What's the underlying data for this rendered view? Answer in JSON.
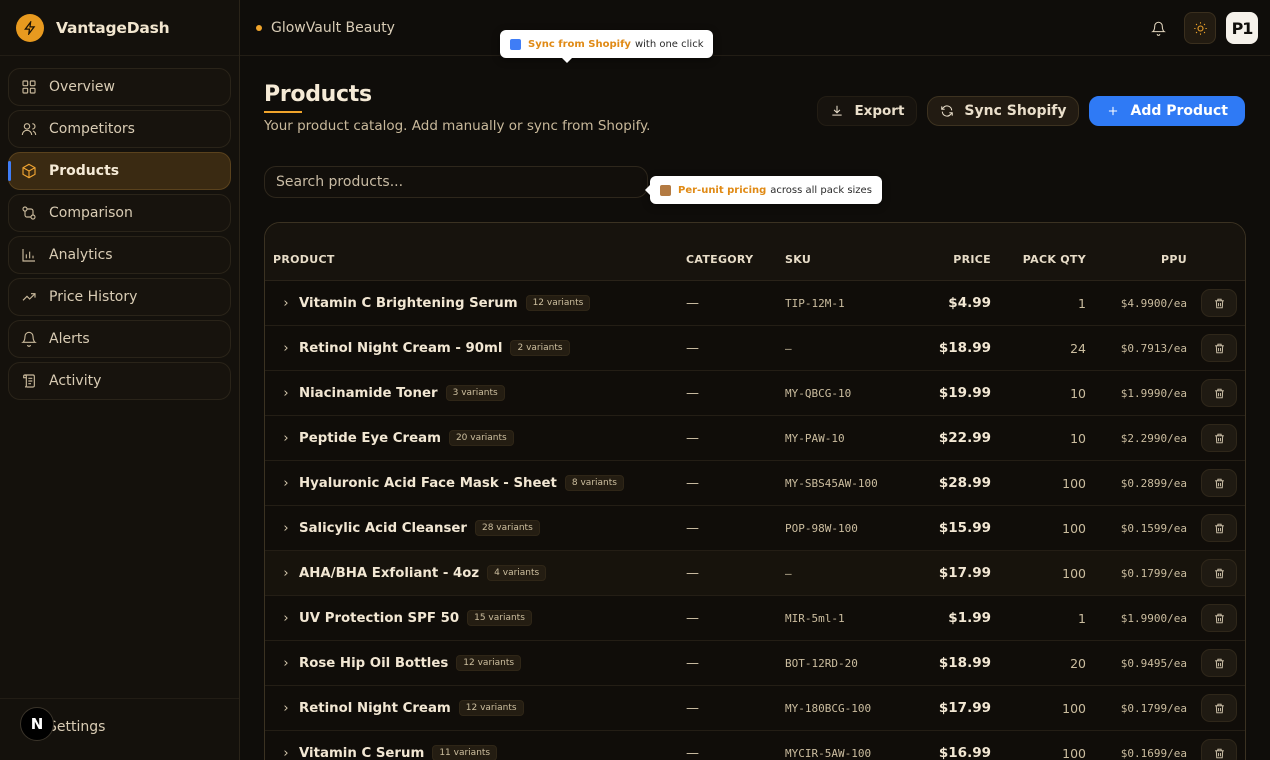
{
  "brand": {
    "name": "VantageDash"
  },
  "nav": [
    {
      "label": "Overview",
      "icon": "grid-icon",
      "active": false
    },
    {
      "label": "Competitors",
      "icon": "users-icon",
      "active": false
    },
    {
      "label": "Products",
      "icon": "box-icon",
      "active": true
    },
    {
      "label": "Comparison",
      "icon": "compare-icon",
      "active": false
    },
    {
      "label": "Analytics",
      "icon": "bar-chart-icon",
      "active": false
    },
    {
      "label": "Price History",
      "icon": "trend-icon",
      "active": false
    },
    {
      "label": "Alerts",
      "icon": "bell-icon",
      "active": false
    },
    {
      "label": "Activity",
      "icon": "scroll-icon",
      "active": false
    }
  ],
  "settings_label": "Settings",
  "next_badge": "N",
  "topbar": {
    "store": "GlowVault Beauty",
    "avatar": "P1"
  },
  "tooltips": {
    "sync_bold": "Sync from Shopify",
    "sync_rest": "with one click",
    "ppu_bold": "Per-unit pricing",
    "ppu_rest": "across all pack sizes"
  },
  "page": {
    "title": "Products",
    "subtitle": "Your product catalog. Add manually or sync from Shopify."
  },
  "actions": {
    "export": "Export",
    "sync": "Sync Shopify",
    "add": "Add Product"
  },
  "search": {
    "placeholder": "Search products..."
  },
  "table": {
    "headers": {
      "product": "PRODUCT",
      "category": "CATEGORY",
      "sku": "SKU",
      "price": "PRICE",
      "pack_qty": "PACK QTY",
      "ppu": "PPU"
    },
    "rows": [
      {
        "name": "Vitamin C Brightening Serum",
        "variants": "12 variants",
        "category": "—",
        "sku": "TIP-12M-1",
        "price": "$4.99",
        "qty": "1",
        "ppu": "$4.9900/ea"
      },
      {
        "name": "Retinol Night Cream - 90ml",
        "variants": "2 variants",
        "category": "—",
        "sku": "–",
        "price": "$18.99",
        "qty": "24",
        "ppu": "$0.7913/ea"
      },
      {
        "name": "Niacinamide Toner",
        "variants": "3 variants",
        "category": "—",
        "sku": "MY-QBCG-10",
        "price": "$19.99",
        "qty": "10",
        "ppu": "$1.9990/ea"
      },
      {
        "name": "Peptide Eye Cream",
        "variants": "20 variants",
        "category": "—",
        "sku": "MY-PAW-10",
        "price": "$22.99",
        "qty": "10",
        "ppu": "$2.2990/ea"
      },
      {
        "name": "Hyaluronic Acid Face Mask - Sheet",
        "variants": "8 variants",
        "category": "—",
        "sku": "MY-SBS45AW-100",
        "price": "$28.99",
        "qty": "100",
        "ppu": "$0.2899/ea"
      },
      {
        "name": "Salicylic Acid Cleanser",
        "variants": "28 variants",
        "category": "—",
        "sku": "POP-98W-100",
        "price": "$15.99",
        "qty": "100",
        "ppu": "$0.1599/ea"
      },
      {
        "name": "AHA/BHA Exfoliant - 4oz",
        "variants": "4 variants",
        "category": "—",
        "sku": "–",
        "price": "$17.99",
        "qty": "100",
        "ppu": "$0.1799/ea"
      },
      {
        "name": "UV Protection SPF 50",
        "variants": "15 variants",
        "category": "—",
        "sku": "MIR-5ml-1",
        "price": "$1.99",
        "qty": "1",
        "ppu": "$1.9900/ea"
      },
      {
        "name": "Rose Hip Oil Bottles",
        "variants": "12 variants",
        "category": "—",
        "sku": "BOT-12RD-20",
        "price": "$18.99",
        "qty": "20",
        "ppu": "$0.9495/ea"
      },
      {
        "name": "Retinol Night Cream",
        "variants": "12 variants",
        "category": "—",
        "sku": "MY-180BCG-100",
        "price": "$17.99",
        "qty": "100",
        "ppu": "$0.1799/ea"
      },
      {
        "name": "Vitamin C Serum",
        "variants": "11 variants",
        "category": "—",
        "sku": "MYCIR-5AW-100",
        "price": "$16.99",
        "qty": "100",
        "ppu": "$0.1699/ea"
      }
    ]
  }
}
